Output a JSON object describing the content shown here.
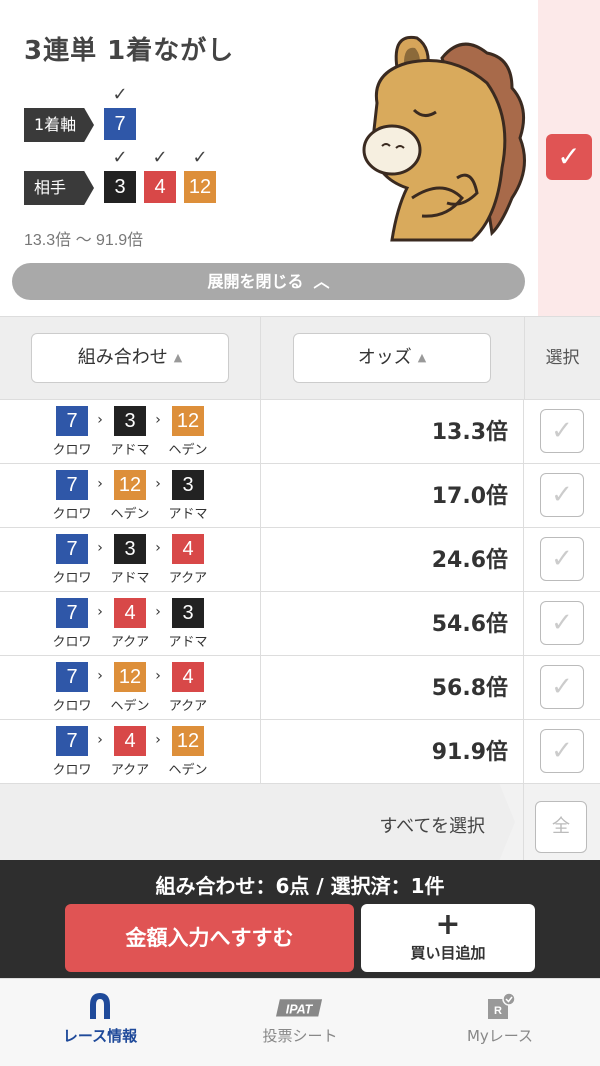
{
  "header": {
    "title": "3連単 1着ながし",
    "axis_label": "1着軸",
    "axis_number": "7",
    "partner_label": "相手",
    "partner_numbers": [
      "3",
      "4",
      "12"
    ],
    "check": "✓",
    "odds_range": "13.3倍 〜 91.9倍",
    "collapse_label": "展開を閉じる"
  },
  "sort": {
    "combination_label": "組み合わせ",
    "odds_label": "オッズ",
    "select_label": "選択"
  },
  "rows": [
    {
      "nums": [
        "7",
        "3",
        "12"
      ],
      "names": [
        "クロワ",
        "アドマ",
        "ヘデン"
      ],
      "colors": [
        "blue",
        "black",
        "orange"
      ],
      "odds": "13.3倍"
    },
    {
      "nums": [
        "7",
        "12",
        "3"
      ],
      "names": [
        "クロワ",
        "ヘデン",
        "アドマ"
      ],
      "colors": [
        "blue",
        "orange",
        "black"
      ],
      "odds": "17.0倍"
    },
    {
      "nums": [
        "7",
        "3",
        "4"
      ],
      "names": [
        "クロワ",
        "アドマ",
        "アクア"
      ],
      "colors": [
        "blue",
        "black",
        "red"
      ],
      "odds": "24.6倍"
    },
    {
      "nums": [
        "7",
        "4",
        "3"
      ],
      "names": [
        "クロワ",
        "アクア",
        "アドマ"
      ],
      "colors": [
        "blue",
        "red",
        "black"
      ],
      "odds": "54.6倍"
    },
    {
      "nums": [
        "7",
        "12",
        "4"
      ],
      "names": [
        "クロワ",
        "ヘデン",
        "アクア"
      ],
      "colors": [
        "blue",
        "orange",
        "red"
      ],
      "odds": "56.8倍"
    },
    {
      "nums": [
        "7",
        "4",
        "12"
      ],
      "names": [
        "クロワ",
        "アクア",
        "ヘデン"
      ],
      "colors": [
        "blue",
        "red",
        "orange"
      ],
      "odds": "91.9倍"
    }
  ],
  "select_all": {
    "label": "すべてを選択",
    "button": "全"
  },
  "action": {
    "summary": "組み合わせ：6点 / 選択済：1件",
    "proceed": "金額入力へすすむ",
    "add_plus": "+",
    "add": "買い目追加"
  },
  "tabs": [
    {
      "label": "レース情報",
      "icon": "horseshoe-icon",
      "active": true
    },
    {
      "label": "投票シート",
      "icon": "ipat-icon",
      "icon_text": "IPAT",
      "active": false
    },
    {
      "label": "Myレース",
      "icon": "my-race-icon",
      "icon_text": "R",
      "active": false
    }
  ],
  "colors": {
    "blue": "#2f57a8",
    "black": "#222222",
    "red": "#d84848",
    "orange": "#dd8f3a",
    "accent": "#e05454",
    "tab_active": "#1f4a9a"
  }
}
